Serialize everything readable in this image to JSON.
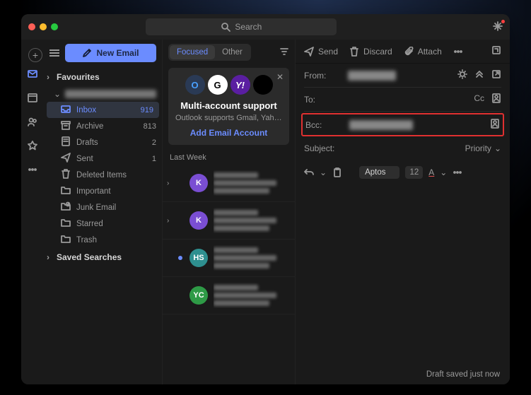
{
  "search": {
    "placeholder": "Search"
  },
  "newEmailLabel": "New Email",
  "sections": {
    "favourites": "Favourites",
    "savedSearches": "Saved Searches"
  },
  "folders": [
    {
      "icon": "inbox",
      "label": "Inbox",
      "count": "919",
      "selected": true
    },
    {
      "icon": "archive",
      "label": "Archive",
      "count": "813",
      "selected": false
    },
    {
      "icon": "drafts",
      "label": "Drafts",
      "count": "2",
      "selected": false
    },
    {
      "icon": "sent",
      "label": "Sent",
      "count": "1",
      "selected": false
    },
    {
      "icon": "trash",
      "label": "Deleted Items",
      "count": "",
      "selected": false
    },
    {
      "icon": "folder",
      "label": "Important",
      "count": "",
      "selected": false
    },
    {
      "icon": "junk",
      "label": "Junk Email",
      "count": "",
      "selected": false
    },
    {
      "icon": "folder",
      "label": "Starred",
      "count": "",
      "selected": false
    },
    {
      "icon": "folder",
      "label": "Trash",
      "count": "",
      "selected": false
    }
  ],
  "tabs": {
    "focused": "Focused",
    "other": "Other"
  },
  "promo": {
    "title": "Multi-account support",
    "sub": "Outlook supports Gmail, Yahoo an…",
    "cta": "Add Email Account"
  },
  "listHeader": "Last Week",
  "messages": [
    {
      "initials": "K",
      "color": "#7a4ed3",
      "unread": false,
      "expandable": true
    },
    {
      "initials": "K",
      "color": "#7a4ed3",
      "unread": false,
      "expandable": true
    },
    {
      "initials": "HS",
      "color": "#2e8f8f",
      "unread": true,
      "expandable": false
    },
    {
      "initials": "YC",
      "color": "#2e9a46",
      "unread": false,
      "expandable": false
    }
  ],
  "compose": {
    "actions": {
      "send": "Send",
      "discard": "Discard",
      "attach": "Attach"
    },
    "labels": {
      "from": "From:",
      "to": "To:",
      "bcc": "Bcc:",
      "subject": "Subject:",
      "cc": "Cc",
      "priority": "Priority"
    },
    "font": "Aptos",
    "fontSize": "12",
    "status": "Draft saved just now"
  }
}
